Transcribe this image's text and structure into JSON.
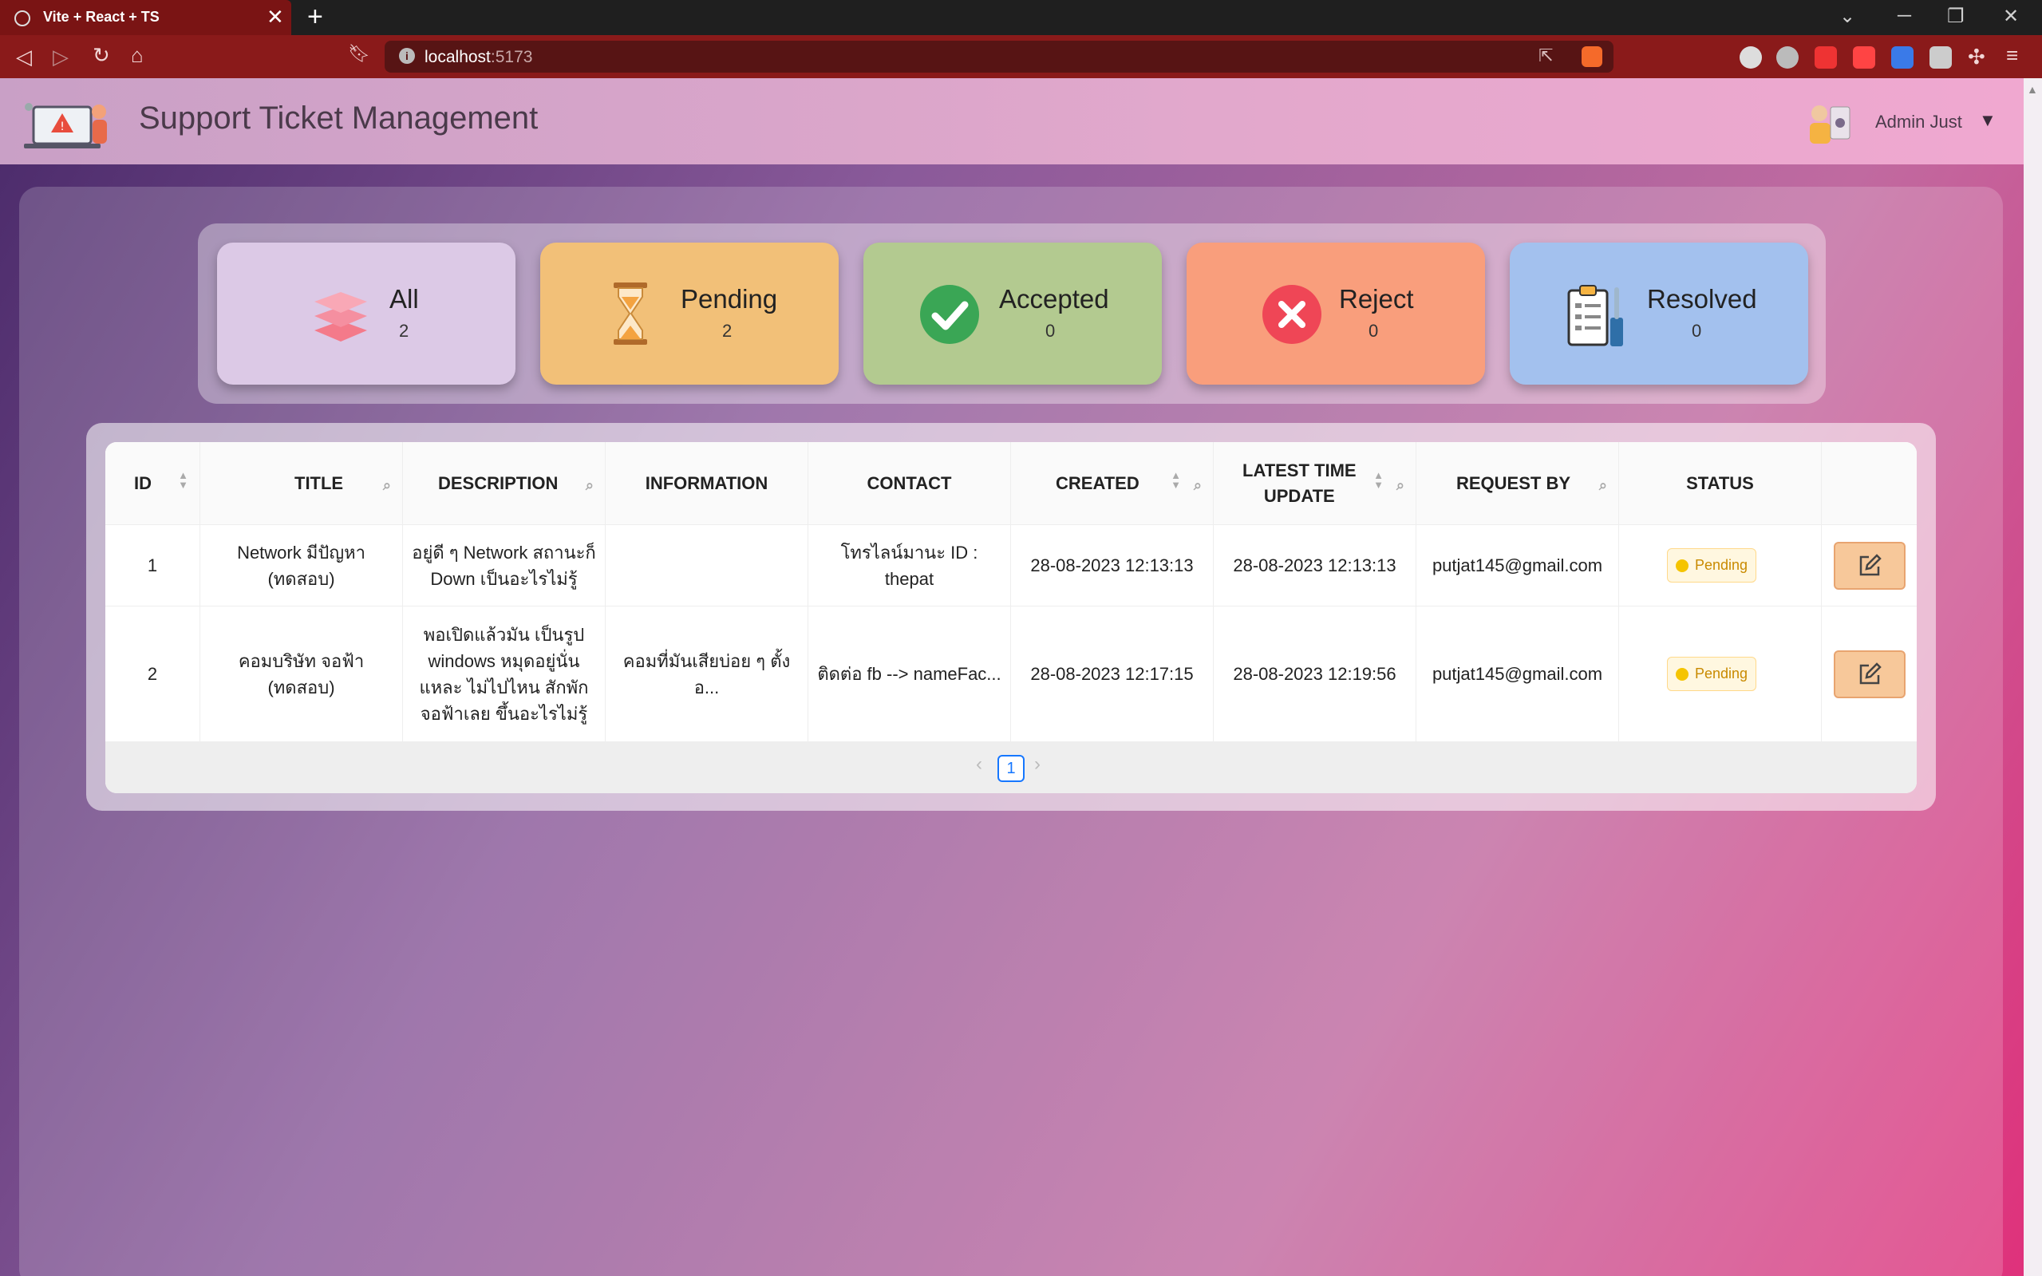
{
  "browser": {
    "tab_title": "Vite + React + TS",
    "close_glyph": "✕",
    "newtab_glyph": "+",
    "url_host": "localhost",
    "url_port": ":5173"
  },
  "app": {
    "title": "Support Ticket Management",
    "user_name": "Admin Just"
  },
  "summary": [
    {
      "label": "All",
      "count": "2",
      "color": "#dcc9e6",
      "icon": "layers-icon"
    },
    {
      "label": "Pending",
      "count": "2",
      "color": "#f2c078",
      "icon": "hourglass-icon"
    },
    {
      "label": "Accepted",
      "count": "0",
      "color": "#b3ca90",
      "icon": "check-circle-icon"
    },
    {
      "label": "Reject",
      "count": "0",
      "color": "#f99e7c",
      "icon": "x-circle-icon"
    },
    {
      "label": "Resolved",
      "count": "0",
      "color": "#a3c1ee",
      "icon": "clipboard-tools-icon"
    }
  ],
  "table": {
    "headers": {
      "id": "ID",
      "title": "TITLE",
      "description": "DESCRIPTION",
      "information": "INFORMATION",
      "contact": "CONTACT",
      "created": "CREATED",
      "latest_line1": "LATEST TIME",
      "latest_line2": "UPDATE",
      "request_by": "REQUEST BY",
      "status": "STATUS"
    },
    "rows": [
      {
        "id": "1",
        "title": "Network มีปัญหา (ทดสอบ)",
        "description": "อยู่ดี ๆ Network สถานะก็ Down เป็นอะไรไม่รู้",
        "information": "",
        "contact": "โทรไลน์มานะ ID : thepat",
        "created": "28-08-2023 12:13:13",
        "latest_update": "28-08-2023 12:13:13",
        "request_by": "putjat145@gmail.com",
        "status": "Pending"
      },
      {
        "id": "2",
        "title": "คอมบริษัท จอฟ้า (ทดสอบ)",
        "description": "พอเปิดแล้วมัน เป็นรูป windows หมุดอยู่นั่นแหละ ไม่ไปไหน สักพัก จอฟ้าเลย ขึ้นอะไรไม่รู้",
        "information": "คอมที่มันเสียบ่อย ๆ ตั้งอ...",
        "contact": "ติดต่อ fb --> nameFac...",
        "created": "28-08-2023 12:17:15",
        "latest_update": "28-08-2023 12:19:56",
        "request_by": "putjat145@gmail.com",
        "status": "Pending"
      }
    ],
    "pagination": {
      "current": "1",
      "prev": "‹",
      "next": "›"
    }
  }
}
